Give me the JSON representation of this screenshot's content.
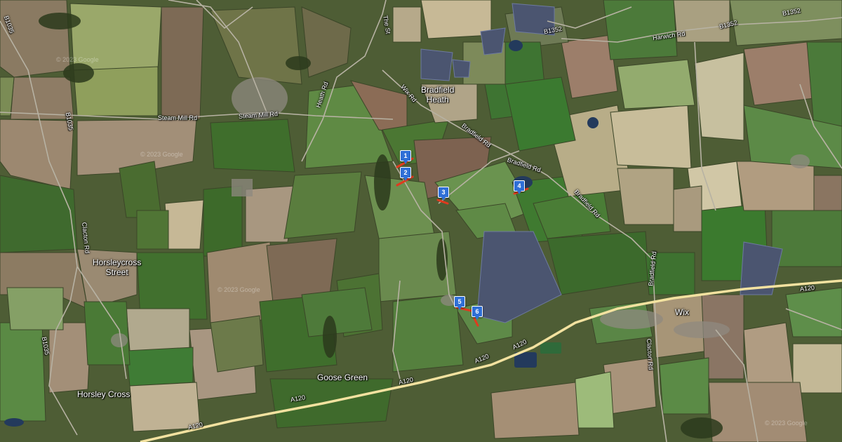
{
  "map": {
    "places": [
      {
        "id": "bradfield-heath",
        "lines": [
          "Bradfield",
          "Heath"
        ]
      },
      {
        "id": "horsleycross-street",
        "lines": [
          "Horsleycross",
          "Street"
        ]
      },
      {
        "id": "goose-green",
        "lines": [
          "Goose Green"
        ]
      },
      {
        "id": "wix",
        "lines": [
          "Wix"
        ]
      },
      {
        "id": "horsley-cross",
        "lines": [
          "Horsley Cross"
        ]
      }
    ],
    "roads": {
      "b1352_a": "B1352",
      "b1352_b": "B1352",
      "b1352_c": "B1352",
      "harwich_rd": "Harwich Rd",
      "the_st": "The St",
      "heath_rd": "Heath Rd",
      "wix_rd": "Wix Rd",
      "bradfield_rd_a": "Bradfield Rd",
      "bradfield_rd_b": "Bradfield Rd",
      "bradfield_rd_c": "Bradfield Rd",
      "bradfield_rd_d": "Bradfield Rd",
      "steam_mill_rd_a": "Steam Mill Rd",
      "steam_mill_rd_b": "Steam Mill Rd",
      "b1035_a": "B1035",
      "b1035_b": "B1035",
      "b1035_c": "B1035",
      "clacton_rd_a": "Clacton Rd",
      "clacton_rd_b": "Clacton Rd",
      "a120_a": "A120",
      "a120_b": "A120",
      "a120_c": "A120",
      "a120_d": "A120",
      "a120_e": "A120",
      "a120_f": "A120"
    },
    "markers": [
      "1",
      "2",
      "3",
      "4",
      "5",
      "6"
    ],
    "copyright": "© 2023 Google",
    "colors": {
      "marker": "#2f6fd6",
      "highlight": "#e03a1e",
      "major_road": "#f3e2a0"
    }
  }
}
